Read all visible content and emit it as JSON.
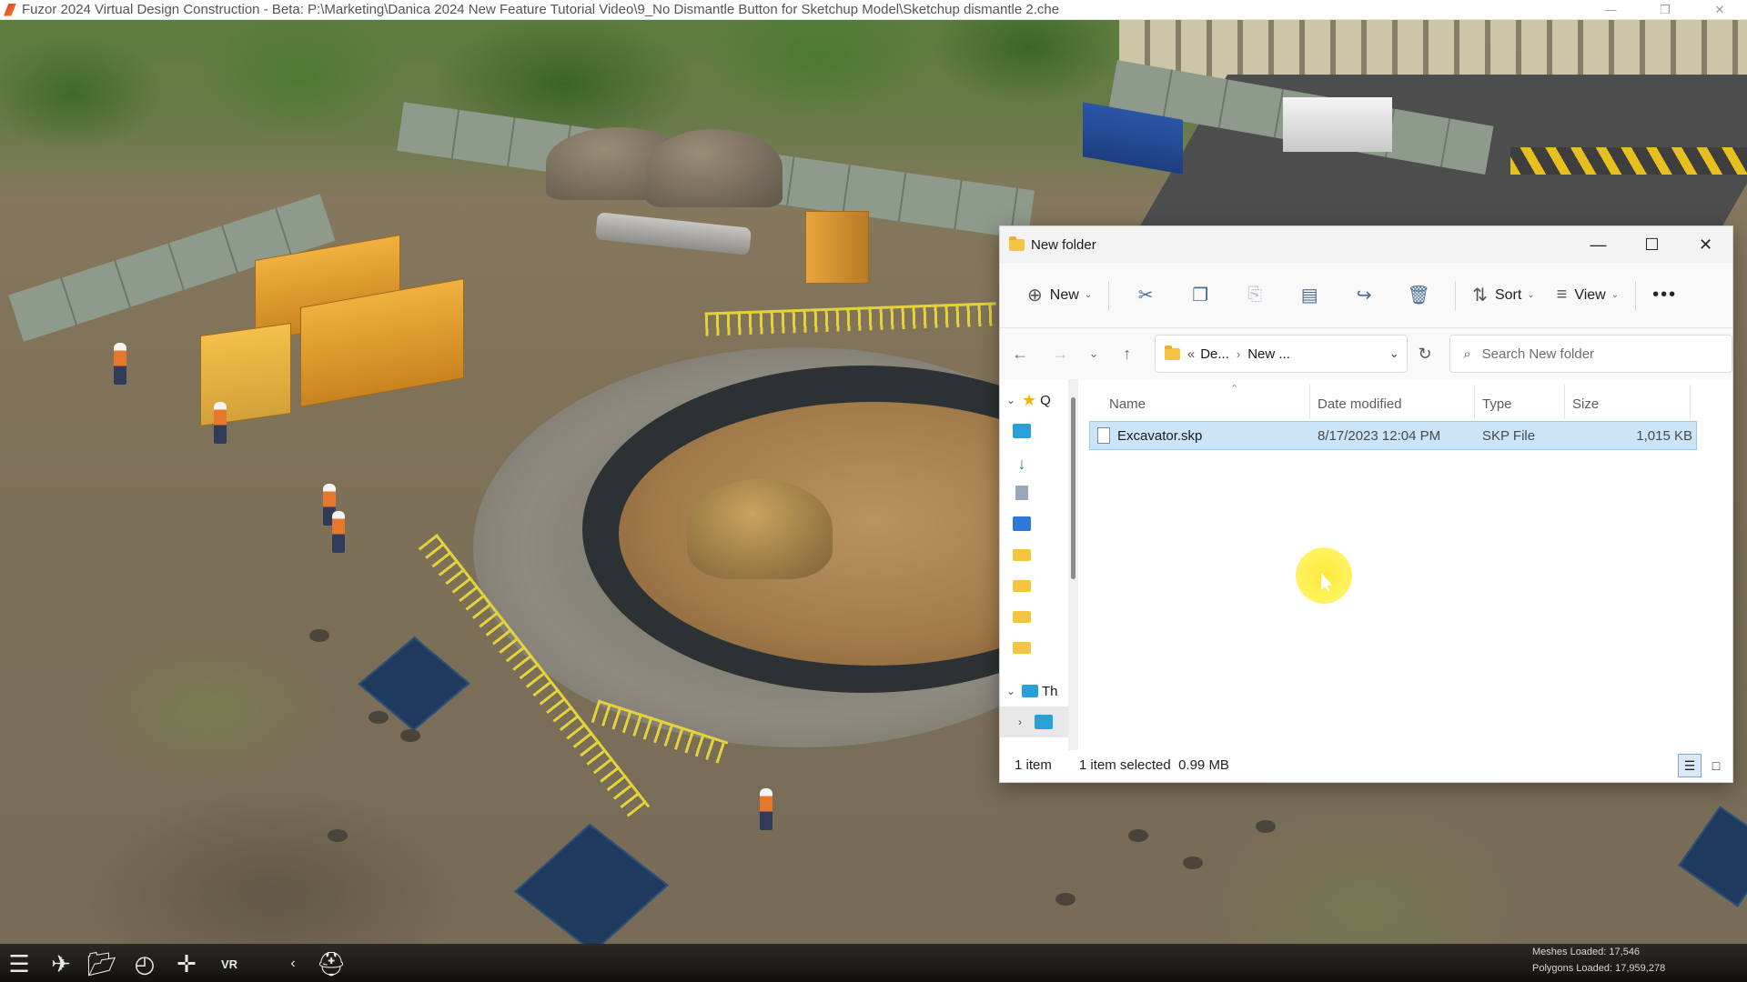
{
  "app": {
    "title": "Fuzor 2024 Virtual Design Construction - Beta: P:\\Marketing\\Danica 2024 New Feature Tutorial Video\\9_No Dismantle Button for Sketchup Model\\Sketchup dismantle 2.che",
    "window_controls": [
      "minimize-icon",
      "restore-icon",
      "close-icon"
    ]
  },
  "toolbar": {
    "buttons": [
      "menu-icon",
      "crane-icon",
      "folder-icon",
      "clock-icon",
      "move-arrows-icon",
      "vr-icon",
      "collapse-chevron-icon",
      "worker-helmet-icon"
    ],
    "vr_label": "VR",
    "stats": {
      "meshes_label": "Meshes Loaded:",
      "meshes_value": "17,546",
      "polygons_label": "Polygons Loaded:",
      "polygons_value": "17,959,278"
    }
  },
  "dialog": {
    "title": "New folder",
    "commands": {
      "new_label": "New",
      "sort_label": "Sort",
      "view_label": "View",
      "icons": [
        "cut-icon",
        "copy-icon",
        "paste-icon",
        "rename-icon",
        "share-icon",
        "delete-icon"
      ]
    },
    "address": {
      "prefix": "«",
      "part1": "De...",
      "part2": "New ..."
    },
    "search_placeholder": "Search New folder",
    "nav_pane": {
      "quick_access_label": "Q",
      "this_pc_label": "Th",
      "items": [
        "desktop-icon",
        "downloads-icon",
        "documents-icon",
        "pictures-icon",
        "folder-icon",
        "folder-icon",
        "folder-icon",
        "folder-icon"
      ]
    },
    "columns": [
      "Name",
      "Date modified",
      "Type",
      "Size"
    ],
    "files": [
      {
        "name": "Excavator.skp",
        "date": "8/17/2023 12:04 PM",
        "type": "SKP File",
        "size": "1,015 KB"
      }
    ],
    "status": {
      "count": "1 item",
      "selection": "1 item selected  0.99 MB"
    }
  }
}
